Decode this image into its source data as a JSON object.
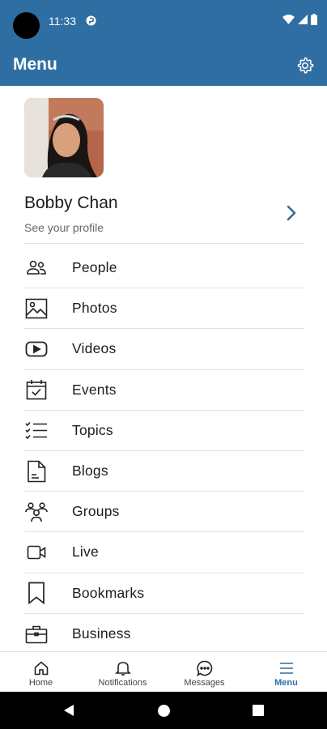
{
  "status_bar": {
    "time": "11:33"
  },
  "app_bar": {
    "title": "Menu",
    "settings_icon": "gear-icon"
  },
  "profile": {
    "name": "Bobby Chan",
    "subtitle": "See your profile"
  },
  "menu": {
    "items": [
      {
        "label": "People",
        "icon": "people-icon"
      },
      {
        "label": "Photos",
        "icon": "image-icon"
      },
      {
        "label": "Videos",
        "icon": "play-icon"
      },
      {
        "label": "Events",
        "icon": "calendar-check-icon"
      },
      {
        "label": "Topics",
        "icon": "checklist-icon"
      },
      {
        "label": "Blogs",
        "icon": "document-icon"
      },
      {
        "label": "Groups",
        "icon": "group-icon"
      },
      {
        "label": "Live",
        "icon": "video-camera-icon"
      },
      {
        "label": "Bookmarks",
        "icon": "bookmark-icon"
      },
      {
        "label": "Business",
        "icon": "briefcase-icon"
      }
    ]
  },
  "bottom_nav": {
    "tabs": [
      {
        "label": "Home",
        "icon": "home-icon",
        "active": false
      },
      {
        "label": "Notifications",
        "icon": "bell-icon",
        "active": false
      },
      {
        "label": "Messages",
        "icon": "chat-icon",
        "active": false
      },
      {
        "label": "Menu",
        "icon": "menu-icon",
        "active": true
      }
    ]
  },
  "colors": {
    "brand": "#2f6ea3",
    "divider": "#e2e2e2"
  }
}
